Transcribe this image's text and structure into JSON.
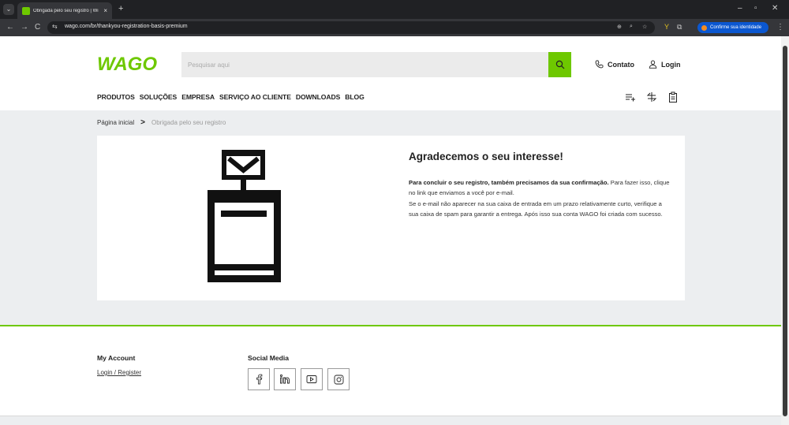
{
  "browser": {
    "tab_title": "Obrigada pelo seu registro | Wi",
    "tab_close": "×",
    "new_tab": "+",
    "url": "wago.com/br/thankyou-registration-basis-premium",
    "identity_label": "Confirme sua identidade",
    "controls": {
      "minimize": "–",
      "restore": "▫",
      "close": "✕",
      "menu": "⋮",
      "back": "←",
      "forward": "→",
      "reload": "C"
    }
  },
  "header": {
    "logo_text": "WAGO",
    "search": {
      "placeholder": "Pesquisar aqui",
      "value": ""
    },
    "contact_label": "Contato",
    "login_label": "Login",
    "nav": [
      {
        "label": "PRODUTOS"
      },
      {
        "label": "SOLUÇÕES"
      },
      {
        "label": "EMPRESA"
      },
      {
        "label": "SERVIÇO AO CLIENTE"
      },
      {
        "label": "DOWNLOADS"
      },
      {
        "label": "BLOG"
      }
    ],
    "tools": [
      "list-add-icon",
      "compare-icon",
      "clipboard-icon"
    ]
  },
  "breadcrumb": {
    "home": "Página inicial",
    "separator": ">",
    "current": "Obrigada pelo seu registro"
  },
  "confirmation": {
    "title": "Agradecemos o seu interesse!",
    "bold_lead": "Para concluir o seu registro, também precisamos da sua confirmação.",
    "line1_rest": " Para fazer isso, clique no link que enviamos a você por e-mail.",
    "line2": "Se o e-mail não aparecer na sua caixa de entrada em um prazo relativamente curto, verifique a sua caixa de spam para garantir a entrega. Após isso sua conta WAGO foi criada com sucesso.",
    "illustration": "mailbox-icon"
  },
  "footer": {
    "account_heading": "My Account",
    "account_link": "Login / Register",
    "social_heading": "Social Media",
    "social": [
      "facebook-icon",
      "linkedin-icon",
      "youtube-icon",
      "instagram-icon"
    ]
  },
  "colors": {
    "brand_green": "#6ec800",
    "page_bg": "#eceef0",
    "chrome_dark": "#202124"
  }
}
